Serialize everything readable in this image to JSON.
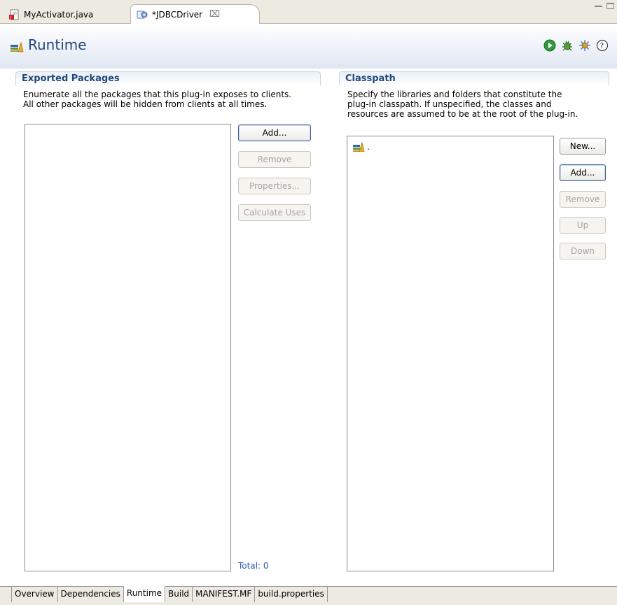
{
  "editor_tabs": [
    {
      "label": "MyActivator.java",
      "icon": "java-file-icon",
      "active": false
    },
    {
      "label": "*JDBCDriver",
      "icon": "plugin-manifest-icon",
      "active": true
    }
  ],
  "close_glyph": "⌧",
  "header": {
    "title": "Runtime",
    "icon": "runtime-library-icon",
    "tools": [
      "run-icon",
      "debug-icon",
      "plugin-export-icon",
      "help-icon"
    ]
  },
  "exported": {
    "title": "Exported Packages",
    "description_line1": "Enumerate all the packages that this plug-in exposes to clients.",
    "description_line2": "All other packages will be hidden from clients at all times.",
    "buttons": {
      "add": "Add...",
      "remove": "Remove",
      "properties": "Properties...",
      "calculate": "Calculate Uses"
    },
    "total": "Total: 0"
  },
  "classpath": {
    "title": "Classpath",
    "description_line1": "Specify the libraries and folders that constitute the",
    "description_line2": "plug-in classpath.  If unspecified, the classes and",
    "description_line3": "resources are assumed to be at the root of the plug-in.",
    "entries": [
      "."
    ],
    "buttons": {
      "new": "New...",
      "add": "Add...",
      "remove": "Remove",
      "up": "Up",
      "down": "Down"
    }
  },
  "page_tabs": [
    "Overview",
    "Dependencies",
    "Runtime",
    "Build",
    "MANIFEST.MF",
    "build.properties"
  ],
  "active_page_tab": "Runtime",
  "colors": {
    "title_blue": "#24477a",
    "link_blue": "#2a5db0",
    "tab_bg": "#eceae1"
  }
}
